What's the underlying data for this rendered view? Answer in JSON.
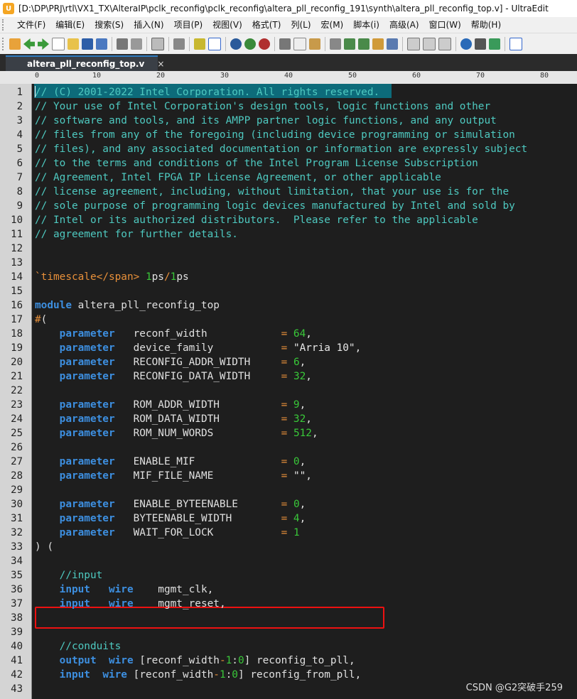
{
  "window": {
    "title": "[D:\\DP\\PRJ\\rtl\\VX1_TX\\AlteraIP\\pclk_reconfig\\pclk_reconfig\\altera_pll_reconfig_191\\synth\\altera_pll_reconfig_top.v] - UltraEdit",
    "app_icon": "ultraedit-icon"
  },
  "menu": [
    "文件(F)",
    "编辑(E)",
    "搜索(S)",
    "插入(N)",
    "项目(P)",
    "视图(V)",
    "格式(T)",
    "列(L)",
    "宏(M)",
    "脚本(i)",
    "高级(A)",
    "窗口(W)",
    "帮助(H)"
  ],
  "tab": {
    "label": "altera_pll_reconfig_top.v",
    "close": "×"
  },
  "ruler": {
    "labels": [
      "0",
      "10",
      "20",
      "30",
      "40",
      "50",
      "60",
      "70",
      "80"
    ]
  },
  "watermark": "CSDN @G2突破手259",
  "colors": {
    "comment": "#4ec9c0",
    "keyword": "#3d8fe0",
    "number": "#39c839",
    "highlight": "#e11111"
  },
  "lines": [
    "// (C) 2001-2022 Intel Corporation. All rights reserved.",
    "// Your use of Intel Corporation's design tools, logic functions and other",
    "// software and tools, and its AMPP partner logic functions, and any output",
    "// files from any of the foregoing (including device programming or simulation",
    "// files), and any associated documentation or information are expressly subject",
    "// to the terms and conditions of the Intel Program License Subscription",
    "// Agreement, Intel FPGA IP License Agreement, or other applicable",
    "// license agreement, including, without limitation, that your use is for the",
    "// sole purpose of programming logic devices manufactured by Intel and sold by",
    "// Intel or its authorized distributors.  Please refer to the applicable",
    "// agreement for further details.",
    "",
    "",
    "`timescale 1ps/1ps",
    "",
    "module altera_pll_reconfig_top",
    "#(",
    "    parameter   reconf_width            = 64,",
    "    parameter   device_family           = \"Arria 10\",",
    "    parameter   RECONFIG_ADDR_WIDTH     = 6,",
    "    parameter   RECONFIG_DATA_WIDTH     = 32,",
    "",
    "    parameter   ROM_ADDR_WIDTH          = 9,",
    "    parameter   ROM_DATA_WIDTH          = 32,",
    "    parameter   ROM_NUM_WORDS           = 512,",
    "",
    "    parameter   ENABLE_MIF              = 0,",
    "    parameter   MIF_FILE_NAME           = \"\",",
    "",
    "    parameter   ENABLE_BYTEENABLE       = 0,",
    "    parameter   BYTEENABLE_WIDTH        = 4,",
    "    parameter   WAIT_FOR_LOCK           = 1",
    ") (",
    "",
    "    //input",
    "    input   wire    mgmt_clk,",
    "    input   wire    mgmt_reset,",
    "",
    "",
    "    //conduits",
    "    output  wire [reconf_width-1:0] reconfig_to_pll,",
    "    input  wire [reconf_width-1:0] reconfig_from_pll,",
    ""
  ]
}
